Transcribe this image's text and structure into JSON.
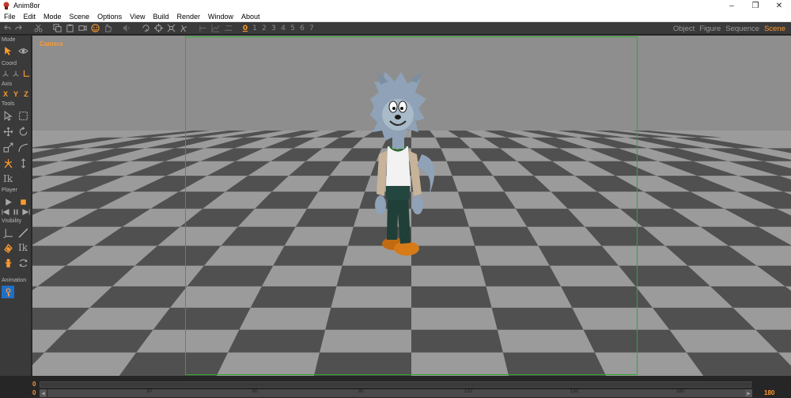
{
  "window": {
    "title": "Anim8or"
  },
  "menu": [
    "File",
    "Edit",
    "Mode",
    "Scene",
    "Options",
    "View",
    "Build",
    "Render",
    "Window",
    "About"
  ],
  "toolbar": {
    "frames": [
      "0",
      "1",
      "2",
      "3",
      "4",
      "5",
      "6",
      "7"
    ],
    "active_frame": "0",
    "modes": [
      "Object",
      "Figure",
      "Sequence",
      "Scene"
    ],
    "active_mode": "Scene"
  },
  "left_panel": {
    "sections": {
      "mode": "Mode",
      "coord": "Coord",
      "axis": "Axis",
      "tools": "Tools",
      "player": "Player",
      "visibility": "Visibility",
      "animation": "Animation"
    },
    "axis_buttons": [
      "X",
      "Y",
      "Z"
    ],
    "ik_label": "Ik",
    "ik_label2": "Ik"
  },
  "viewport": {
    "camera_label": "Camera"
  },
  "timeline": {
    "start_top": "0",
    "start_bottom": "0",
    "end_bottom": "180",
    "ticks": [
      "30",
      "60",
      "90",
      "120",
      "150",
      "180"
    ]
  },
  "colors": {
    "accent": "#ff9a2e",
    "camera_frame": "#2ea82e",
    "anim_key": "#1f6fc9"
  }
}
